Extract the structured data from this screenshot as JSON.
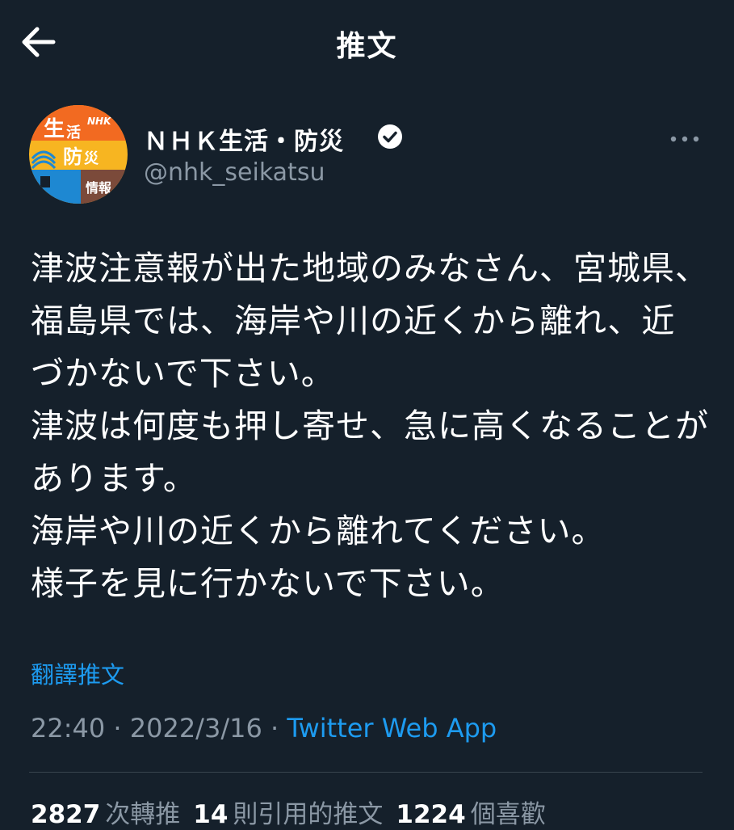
{
  "header": {
    "title": "推文",
    "back_icon": "arrow-left-icon"
  },
  "author": {
    "display_name": "ＮＨＫ生活・防災",
    "handle": "@nhk_seikatsu",
    "verified_icon": "verified-badge-icon",
    "more_icon": "more-horizontal-icon",
    "avatar": {
      "line1": "生活",
      "line2": "防災",
      "line3": "情報",
      "brand": "NHK",
      "colors": {
        "top": "#f26a21",
        "bottom": "#1e88d2",
        "middle": "#f7b521",
        "badge": "#7b4a3a"
      }
    }
  },
  "tweet": {
    "text": "津波注意報が出た地域のみなさん、宮城県、福島県では、海岸や川の近くから離れ、近づかないで下さい。\n津波は何度も押し寄せ、急に高くなることがあります。\n海岸や川の近くから離れてください。\n様子を見に行かないで下さい。",
    "translate_label": "翻譯推文",
    "time": "22:40",
    "date": "2022/3/16",
    "separator": "·",
    "source": "Twitter Web App"
  },
  "stats": {
    "retweets": "2827",
    "retweets_label": "次轉推",
    "quotes": "14",
    "quotes_label": "則引用的推文",
    "likes": "1224",
    "likes_label": "個喜歡"
  },
  "colors": {
    "background": "#15202b",
    "accent": "#1d9bf0",
    "secondary_text": "#8b98a5"
  }
}
